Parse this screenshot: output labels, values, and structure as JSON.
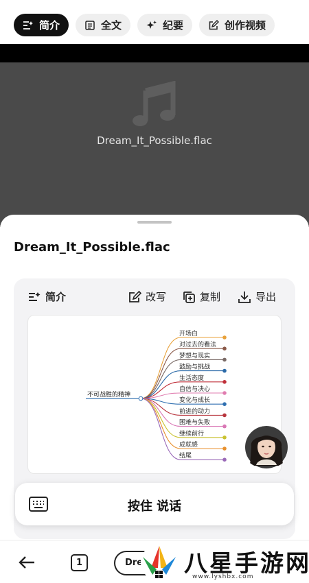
{
  "tabs": [
    {
      "label": "简介",
      "icon": "summary-icon",
      "active": true
    },
    {
      "label": "全文",
      "icon": "document-icon",
      "active": false
    },
    {
      "label": "纪要",
      "icon": "sparkle-icon",
      "active": false
    },
    {
      "label": "创作视频",
      "icon": "edit-icon",
      "active": false
    }
  ],
  "player": {
    "file_name": "Dream_It_Possible.flac",
    "icon": "music-note-icon"
  },
  "sheet": {
    "title": "Dream_It_Possible.flac",
    "card": {
      "summary_label": "简介",
      "rewrite_label": "改写",
      "copy_label": "复制",
      "export_label": "导出"
    },
    "mindmap": {
      "root": "不可战胜的精神",
      "branches": [
        {
          "label": "开场白",
          "color": "#e8a13a"
        },
        {
          "label": "对过去的看法",
          "color": "#8b5a4a"
        },
        {
          "label": "梦想与现实",
          "color": "#7a6a66"
        },
        {
          "label": "鼓励与挑战",
          "color": "#2b6aa8"
        },
        {
          "label": "生活态度",
          "color": "#c0303a"
        },
        {
          "label": "自信与决心",
          "color": "#e07db0"
        },
        {
          "label": "变化与成长",
          "color": "#2f6fb0"
        },
        {
          "label": "前进的动力",
          "color": "#b8353e"
        },
        {
          "label": "困难与失败",
          "color": "#d977b5"
        },
        {
          "label": "继续前行",
          "color": "#c9c230"
        },
        {
          "label": "成就感",
          "color": "#e8912f"
        },
        {
          "label": "结尾",
          "color": "#9a6ab8"
        }
      ]
    },
    "voice_label": "按住 说话"
  },
  "bottom": {
    "pages": "1",
    "pill_text": "Dream_It_Possible"
  },
  "watermark": {
    "text": "八星手游网",
    "url": "www.lyshbx.com"
  }
}
